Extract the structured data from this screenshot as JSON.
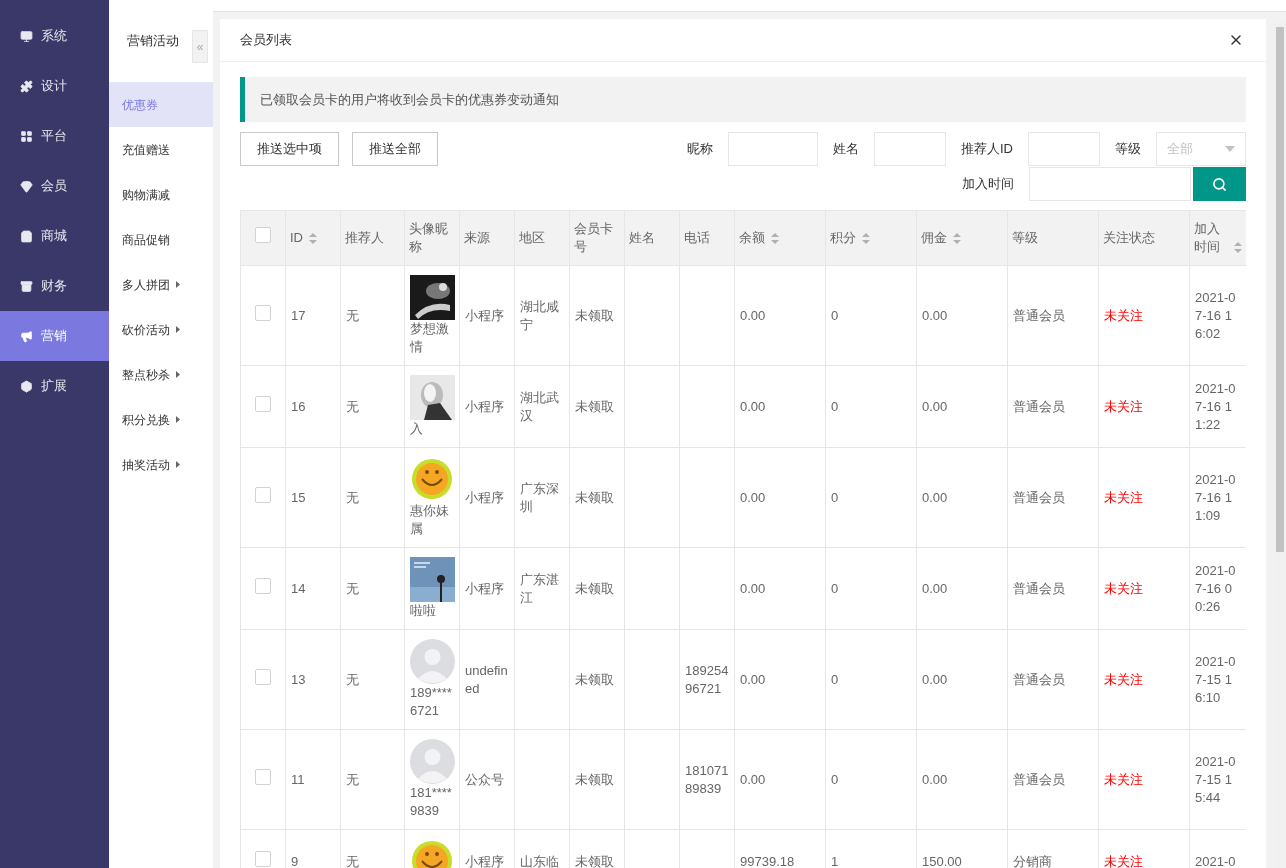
{
  "main_nav": {
    "items": [
      {
        "label": "系统",
        "selected": false
      },
      {
        "label": "设计",
        "selected": false
      },
      {
        "label": "平台",
        "selected": false
      },
      {
        "label": "会员",
        "selected": false
      },
      {
        "label": "商城",
        "selected": false
      },
      {
        "label": "财务",
        "selected": false
      },
      {
        "label": "营销",
        "selected": true
      },
      {
        "label": "扩展",
        "selected": false
      }
    ]
  },
  "sub_nav": {
    "title": "营销活动",
    "collapse": "«",
    "items": [
      {
        "label": "优惠券",
        "kind": "link",
        "selected": true
      },
      {
        "label": "充值赠送",
        "kind": "link",
        "selected": false
      },
      {
        "label": "购物满减",
        "kind": "link",
        "selected": false
      },
      {
        "label": "商品促销",
        "kind": "link",
        "selected": false
      },
      {
        "label": "多人拼团",
        "kind": "group",
        "selected": false
      },
      {
        "label": "砍价活动",
        "kind": "group",
        "selected": false
      },
      {
        "label": "整点秒杀",
        "kind": "group",
        "selected": false
      },
      {
        "label": "积分兑换",
        "kind": "group",
        "selected": false
      },
      {
        "label": "抽奖活动",
        "kind": "group",
        "selected": false
      }
    ]
  },
  "dialog": {
    "title": "会员列表",
    "notice": "已领取会员卡的用户将收到会员卡的优惠券变动通知",
    "buttons": [
      "推送选中项",
      "推送全部"
    ],
    "filters": [
      {
        "label": "昵称",
        "kind": "text"
      },
      {
        "label": "姓名",
        "kind": "text"
      },
      {
        "label": "推荐人ID",
        "kind": "text"
      },
      {
        "label": "等级",
        "kind": "select",
        "placeholder": "全部"
      },
      {
        "label": "加入时间",
        "kind": "text"
      }
    ],
    "table": {
      "select_all_checked": false,
      "columns": [
        {
          "label": "ID",
          "sortable": true
        },
        {
          "label": "推荐人",
          "sortable": false
        },
        {
          "label": "头像昵称",
          "sortable": false
        },
        {
          "label": "来源",
          "sortable": false
        },
        {
          "label": "地区",
          "sortable": false
        },
        {
          "label": "会员卡号",
          "sortable": false
        },
        {
          "label": "姓名",
          "sortable": false
        },
        {
          "label": "电话",
          "sortable": false
        },
        {
          "label": "余额",
          "sortable": true
        },
        {
          "label": "积分",
          "sortable": true
        },
        {
          "label": "佣金",
          "sortable": true
        },
        {
          "label": "等级",
          "sortable": false
        },
        {
          "label": "关注状态",
          "sortable": false
        },
        {
          "label": "加入时间",
          "sortable": true
        }
      ],
      "rows": [
        {
          "checked": false,
          "id": "17",
          "referrer": "无",
          "nickname": "梦想激情",
          "source": "小程序",
          "region": "湖北咸宁",
          "card": "未领取",
          "phone": "",
          "balance": "0.00",
          "points": "0",
          "commission": "0.00",
          "level": "普通会员",
          "follow": "未关注",
          "followed": false,
          "joined": "2021-07-16 16:02"
        },
        {
          "checked": false,
          "id": "16",
          "referrer": "无",
          "nickname": "入",
          "source": "小程序",
          "region": "湖北武汉",
          "card": "未领取",
          "phone": "",
          "balance": "0.00",
          "points": "0",
          "commission": "0.00",
          "level": "普通会员",
          "follow": "未关注",
          "followed": false,
          "joined": "2021-07-16 11:22"
        },
        {
          "checked": false,
          "id": "15",
          "referrer": "无",
          "nickname": "惠你妹属",
          "source": "小程序",
          "region": "广东深圳",
          "card": "未领取",
          "phone": "",
          "balance": "0.00",
          "points": "0",
          "commission": "0.00",
          "level": "普通会员",
          "follow": "未关注",
          "followed": false,
          "joined": "2021-07-16 11:09"
        },
        {
          "checked": false,
          "id": "14",
          "referrer": "无",
          "nickname": "啦啦",
          "source": "小程序",
          "region": "广东湛江",
          "card": "未领取",
          "phone": "",
          "balance": "0.00",
          "points": "0",
          "commission": "0.00",
          "level": "普通会员",
          "follow": "未关注",
          "followed": false,
          "joined": "2021-07-16 00:26"
        },
        {
          "checked": false,
          "id": "13",
          "referrer": "无",
          "avatar": {
            "kind": "default"
          },
          "nickname": "189****6721",
          "source": "undefined",
          "region": "",
          "card": "未领取",
          "phone": "18925496721",
          "balance": "0.00",
          "points": "0",
          "commission": "0.00",
          "level": "普通会员",
          "follow": "未关注",
          "followed": false,
          "joined": "2021-07-15 16:10"
        },
        {
          "checked": false,
          "id": "11",
          "referrer": "无",
          "avatar": {
            "kind": "default"
          },
          "nickname": "181****9839",
          "source": "公众号",
          "region": "",
          "card": "未领取",
          "phone": "18107189839",
          "balance": "0.00",
          "points": "0",
          "commission": "0.00",
          "level": "普通会员",
          "follow": "未关注",
          "followed": false,
          "joined": "2021-07-15 15:44"
        },
        {
          "checked": false,
          "id": "9",
          "referrer": "无",
          "source": "小程序",
          "region": "山东临",
          "card": "未领取",
          "phone": "",
          "balance": "99739.18",
          "points": "1",
          "commission": "150.00",
          "level": "分销商",
          "follow": "未关注",
          "followed": false,
          "joined": "2021-0"
        }
      ]
    }
  }
}
